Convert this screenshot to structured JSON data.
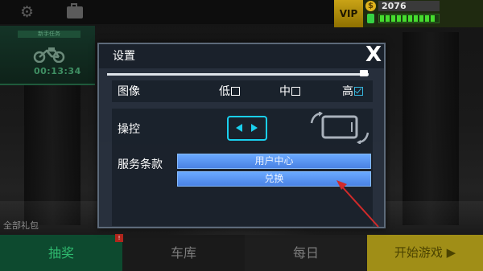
{
  "topbar": {
    "gear_icon": "gear-icon",
    "case_icon": "case-icon"
  },
  "event": {
    "title": "新手任务",
    "timer": "00:13:34",
    "icon": "motorbike-icon"
  },
  "side_label": "全部礼包",
  "hud": {
    "vip": "VIP",
    "coin_symbol": "$",
    "coins": "2076",
    "fuel_segments": 10,
    "fuel_filled": 10
  },
  "nav": {
    "draw": "抽奖",
    "garage": "车库",
    "daily": "每日",
    "start": "开始游戏 ▶",
    "badge": "!"
  },
  "settings": {
    "title": "设置",
    "close": "X",
    "volume_level": 0.98,
    "graphics": {
      "label": "图像",
      "options": [
        {
          "label": "低",
          "checked": false
        },
        {
          "label": "中",
          "checked": false
        },
        {
          "label": "高",
          "checked": true
        }
      ]
    },
    "controls": {
      "label": "操控",
      "selected": "buttons",
      "icons": [
        "buttons-control-icon",
        "tilt-control-icon"
      ]
    },
    "service": {
      "label": "服务条款",
      "buttons": [
        "用户中心",
        "兑换"
      ]
    }
  },
  "colors": {
    "dialog_bg": "#28313e",
    "accent_cyan": "#1ad0ee",
    "button_blue": "#5a96f0",
    "annotation_red": "#d12a2a",
    "fuel_green": "#46dc2e",
    "gold": "#c9a316"
  }
}
